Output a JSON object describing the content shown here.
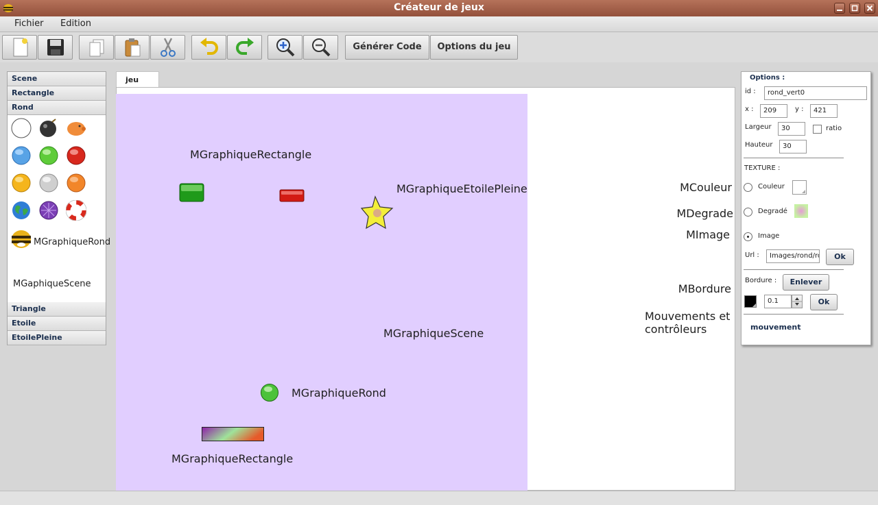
{
  "window": {
    "title": "Créateur de jeux"
  },
  "menu": {
    "file": "Fichier",
    "edit": "Edition"
  },
  "toolbar": {
    "icons": [
      "new-document-icon",
      "save-icon",
      "copy-icon",
      "paste-icon",
      "cut-icon",
      "undo-icon",
      "redo-icon",
      "zoom-in-icon",
      "zoom-out-icon"
    ],
    "generate_code": "Générer Code",
    "game_options": "Options du jeu"
  },
  "palette": {
    "categories": [
      "Scene",
      "Rectangle",
      "Rond",
      "Triangle",
      "Etoile",
      "EtoilePleine"
    ],
    "selected_category": "Rond",
    "item_label_round": "MGraphiqueRond",
    "item_label_scene": "MGaphiqueScene"
  },
  "tab": {
    "label": "jeu"
  },
  "canvas": {
    "labels": {
      "rect_top": "MGraphiqueRectangle",
      "star": "MGraphiqueEtoilePleine",
      "scene": "MGraphiqueScene",
      "round": "MGraphiqueRond",
      "rect_bottom": "MGraphiqueRectangle"
    },
    "annotations": {
      "couleur": "MCouleur",
      "degrade": "MDegrade",
      "image": "MImage",
      "bordure": "MBordure",
      "mouvements_1": "Mouvements et",
      "mouvements_2": "contrôleurs"
    },
    "scene_color": "#e1ceff"
  },
  "options": {
    "title": "Options :",
    "id_label": "id :",
    "id_value": "rond_vert0",
    "x_label": "x :",
    "x_value": "209",
    "y_label": "y :",
    "y_value": "421",
    "width_label": "Largeur",
    "width_value": "30",
    "ratio_label": "ratio",
    "height_label": "Hauteur",
    "height_value": "30",
    "texture_label": "TEXTURE :",
    "color_label": "Couleur",
    "gradient_label": "Degradé",
    "image_label": "Image",
    "selected_texture": "Image",
    "url_label": "Url :",
    "url_value": "Images/rond/rond_vert.png",
    "ok_label": "Ok",
    "border_label": "Bordure :",
    "remove_label": "Enlever",
    "border_width_value": "0.1",
    "border_color": "#000000",
    "movement_label": "mouvement"
  }
}
